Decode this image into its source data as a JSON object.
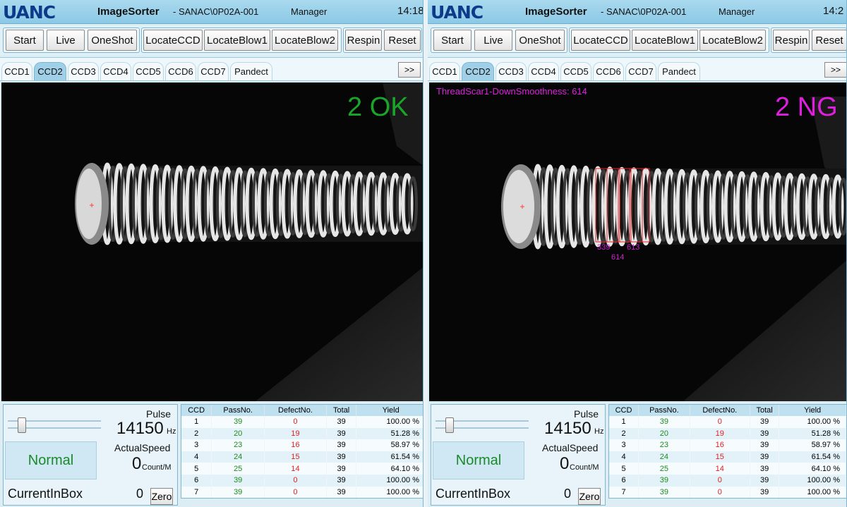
{
  "colors": {
    "ok": "#1aa52a",
    "ng": "#e01ee0",
    "titlebar": "#8cc9e6",
    "accent": "#9fd0e8"
  },
  "panels": [
    {
      "logo": "UANC",
      "app_title": "ImageSorter",
      "app_sub": "- SANAC\\0P02A-001",
      "user": "Manager",
      "clock": "14:18",
      "toolbar": [
        "Start",
        "Live",
        "OneShot",
        "LocateCCD",
        "LocateBlow1",
        "LocateBlow2",
        "Respin",
        "Reset"
      ],
      "tabs": [
        "CCD1",
        "CCD2",
        "CCD3",
        "CCD4",
        "CCD5",
        "CCD6",
        "CCD7",
        "Pandect"
      ],
      "active_tab": "CCD2",
      "tab_nav": ">>",
      "result": "2 OK",
      "defect_text": "",
      "pulse_label": "Pulse",
      "pulse_value": "14150",
      "pulse_unit": "Hz",
      "speed_label": "ActualSpeed",
      "speed_value": "0",
      "speed_unit": "Count/M",
      "mode": "Normal",
      "box_label": "CurrentInBox",
      "box_value": "0",
      "zero_label": "Zero"
    },
    {
      "logo": "UANC",
      "app_title": "ImageSorter",
      "app_sub": "- SANAC\\0P02A-001",
      "user": "Manager",
      "clock": "14:2",
      "toolbar": [
        "Start",
        "Live",
        "OneShot",
        "LocateCCD",
        "LocateBlow1",
        "LocateBlow2",
        "Respin",
        "Reset"
      ],
      "tabs": [
        "CCD1",
        "CCD2",
        "CCD3",
        "CCD4",
        "CCD5",
        "CCD6",
        "CCD7",
        "Pandect"
      ],
      "active_tab": "CCD2",
      "tab_nav": ">>",
      "result": "2 NG",
      "defect_text": "ThreadScar1-DownSmoothness: 614",
      "box_labels": [
        "339",
        "613",
        "614"
      ],
      "pulse_label": "Pulse",
      "pulse_value": "14150",
      "pulse_unit": "Hz",
      "speed_label": "ActualSpeed",
      "speed_value": "0",
      "speed_unit": "Count/M",
      "mode": "Normal",
      "box_label": "CurrentInBox",
      "box_value": "0",
      "zero_label": "Zero"
    }
  ],
  "stats": {
    "headers": [
      "CCD",
      "PassNo.",
      "DefectNo.",
      "Total",
      "Yield"
    ],
    "rows": [
      [
        "1",
        "39",
        "0",
        "39",
        "100.00 %"
      ],
      [
        "2",
        "20",
        "19",
        "39",
        "51.28 %"
      ],
      [
        "3",
        "23",
        "16",
        "39",
        "58.97 %"
      ],
      [
        "4",
        "24",
        "15",
        "39",
        "61.54 %"
      ],
      [
        "5",
        "25",
        "14",
        "39",
        "64.10 %"
      ],
      [
        "6",
        "39",
        "0",
        "39",
        "100.00 %"
      ],
      [
        "7",
        "39",
        "0",
        "39",
        "100.00 %"
      ]
    ]
  }
}
